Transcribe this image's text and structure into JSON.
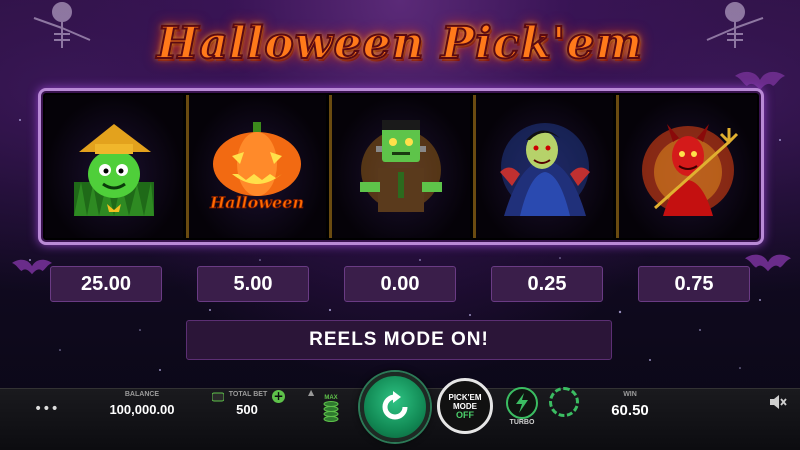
{
  "game": {
    "title": "Halloween Pick'em"
  },
  "reels": [
    {
      "symbol": "scarecrow-icon",
      "value": "25.00"
    },
    {
      "symbol": "pumpkin-icon",
      "value": "5.00",
      "caption": "Halloween"
    },
    {
      "symbol": "frankenstein-icon",
      "value": "0.00"
    },
    {
      "symbol": "dracula-icon",
      "value": "0.25"
    },
    {
      "symbol": "devil-icon",
      "value": "0.75"
    }
  ],
  "mode_banner": "REELS MODE ON!",
  "bottom_bar": {
    "menu": "•••",
    "balance_label": "BALANCE",
    "balance_value": "100,000.00",
    "total_bet_label": "TOTAL BET",
    "total_bet_value": "500",
    "max_label": "MAX",
    "pickem_line1": "PICK'EM",
    "pickem_line2": "MODE",
    "pickem_state": "OFF",
    "turbo_label": "TURBO",
    "win_label": "WIN",
    "win_value": "60.50"
  },
  "colors": {
    "accent_green": "#3bbd62",
    "spin_green": "#1fa66b",
    "frame_purple": "#b98ad6",
    "value_box": "#3a1e4a",
    "title_orange": "#ff7a1a"
  }
}
